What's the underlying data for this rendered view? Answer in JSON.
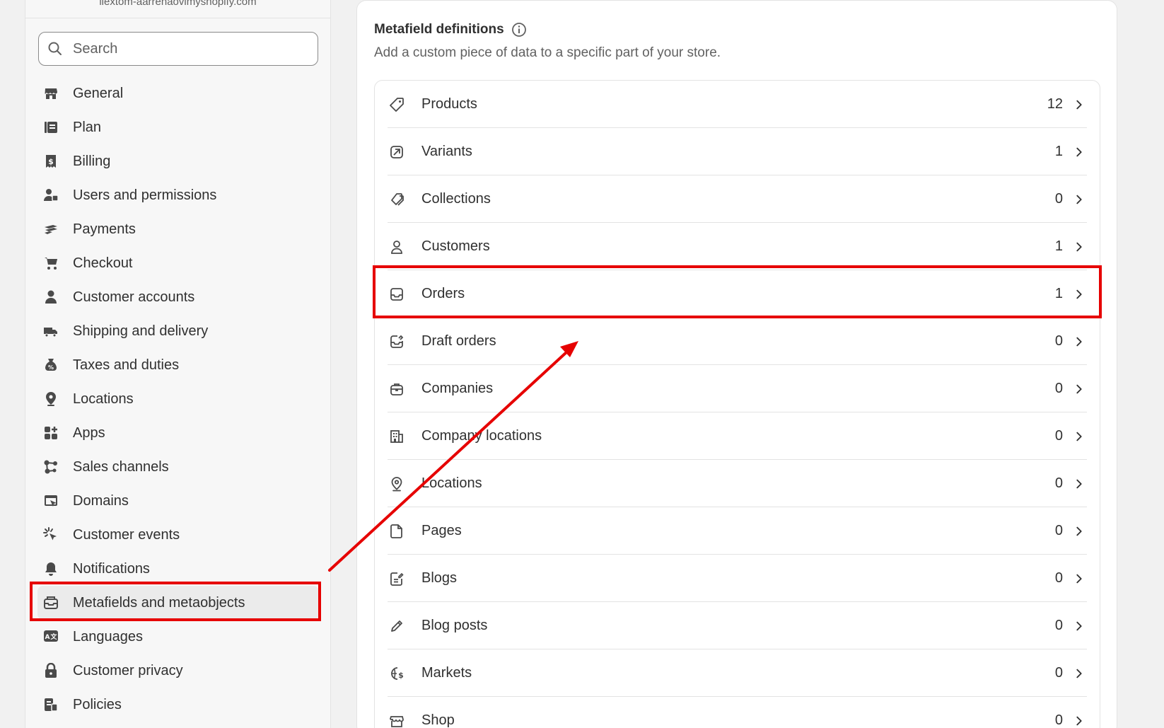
{
  "sidebar": {
    "store_url": "ilextom-aarrenaovimyshopify.com",
    "search": {
      "placeholder": "Search",
      "value": ""
    },
    "items": [
      {
        "label": "General",
        "icon": "store-icon"
      },
      {
        "label": "Plan",
        "icon": "plan-icon"
      },
      {
        "label": "Billing",
        "icon": "billing-icon"
      },
      {
        "label": "Users and permissions",
        "icon": "users-icon"
      },
      {
        "label": "Payments",
        "icon": "payments-icon"
      },
      {
        "label": "Checkout",
        "icon": "cart-icon"
      },
      {
        "label": "Customer accounts",
        "icon": "person-icon"
      },
      {
        "label": "Shipping and delivery",
        "icon": "truck-icon"
      },
      {
        "label": "Taxes and duties",
        "icon": "tax-icon"
      },
      {
        "label": "Locations",
        "icon": "location-pin-icon"
      },
      {
        "label": "Apps",
        "icon": "apps-icon"
      },
      {
        "label": "Sales channels",
        "icon": "channels-icon"
      },
      {
        "label": "Domains",
        "icon": "domains-icon"
      },
      {
        "label": "Customer events",
        "icon": "cursor-click-icon"
      },
      {
        "label": "Notifications",
        "icon": "bell-icon"
      },
      {
        "label": "Metafields and metaobjects",
        "icon": "metafields-icon",
        "active": true
      },
      {
        "label": "Languages",
        "icon": "translate-icon"
      },
      {
        "label": "Customer privacy",
        "icon": "lock-icon"
      },
      {
        "label": "Policies",
        "icon": "policies-icon"
      }
    ]
  },
  "main": {
    "title": "Metafield definitions",
    "subtitle": "Add a custom piece of data to a specific part of your store.",
    "rows": [
      {
        "label": "Products",
        "count": "12",
        "icon": "tag-icon"
      },
      {
        "label": "Variants",
        "count": "1",
        "icon": "variants-icon"
      },
      {
        "label": "Collections",
        "count": "0",
        "icon": "collections-icon"
      },
      {
        "label": "Customers",
        "count": "1",
        "icon": "person-outline-icon"
      },
      {
        "label": "Orders",
        "count": "1",
        "icon": "inbox-icon"
      },
      {
        "label": "Draft orders",
        "count": "0",
        "icon": "draft-order-icon"
      },
      {
        "label": "Companies",
        "count": "0",
        "icon": "briefcase-icon"
      },
      {
        "label": "Company locations",
        "count": "0",
        "icon": "building-icon"
      },
      {
        "label": "Locations",
        "count": "0",
        "icon": "location-outline-icon"
      },
      {
        "label": "Pages",
        "count": "0",
        "icon": "page-icon"
      },
      {
        "label": "Blogs",
        "count": "0",
        "icon": "blog-icon"
      },
      {
        "label": "Blog posts",
        "count": "0",
        "icon": "pencil-icon"
      },
      {
        "label": "Markets",
        "count": "0",
        "icon": "globe-dollar-icon"
      },
      {
        "label": "Shop",
        "count": "0",
        "icon": "shop-icon"
      }
    ]
  },
  "colors": {
    "annotation": "#e60000",
    "active_nav_bg": "#ebebeb",
    "text": "#303030",
    "muted": "#616161"
  }
}
